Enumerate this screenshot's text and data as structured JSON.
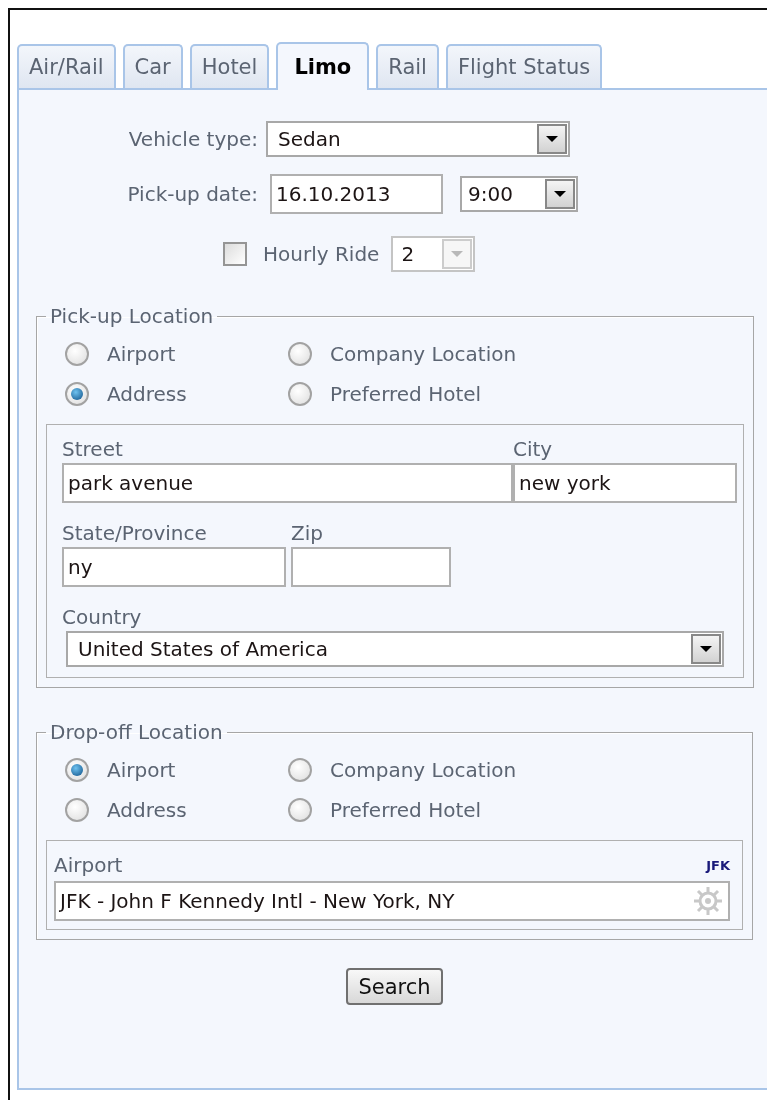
{
  "tabs": [
    {
      "label": "Air/Rail",
      "selected": false
    },
    {
      "label": "Car",
      "selected": false
    },
    {
      "label": "Hotel",
      "selected": false
    },
    {
      "label": "Limo",
      "selected": true
    },
    {
      "label": "Rail",
      "selected": false
    },
    {
      "label": "Flight Status",
      "selected": false
    }
  ],
  "vehicle_type": {
    "label": "Vehicle type:",
    "value": "Sedan"
  },
  "pickup_date": {
    "label": "Pick-up date:",
    "date": "16.10.2013",
    "time": "9:00"
  },
  "hourly_ride": {
    "label": "Hourly Ride",
    "checked": false,
    "hours": "2",
    "hours_disabled": true
  },
  "locations": [
    {
      "legend": "Pick-up Location",
      "kind": "address",
      "options": [
        {
          "label": "Airport",
          "selected": false
        },
        {
          "label": "Company Location",
          "selected": false
        },
        {
          "label": "Address",
          "selected": true
        },
        {
          "label": "Preferred Hotel",
          "selected": false
        }
      ],
      "street": {
        "label": "Street",
        "value": "park avenue"
      },
      "city": {
        "label": "City",
        "value": "new york"
      },
      "state": {
        "label": "State/Province",
        "value": "ny"
      },
      "zip": {
        "label": "Zip"
      },
      "country": {
        "label": "Country",
        "value": "United States of America"
      }
    },
    {
      "legend": "Drop-off Location",
      "kind": "airport",
      "options": [
        {
          "label": "Airport",
          "selected": true
        },
        {
          "label": "Company Location",
          "selected": false
        },
        {
          "label": "Address",
          "selected": false
        },
        {
          "label": "Preferred Hotel",
          "selected": false
        }
      ],
      "airport": {
        "label": "Airport",
        "code": "JFK",
        "value": "JFK - John F Kennedy Intl - New York, NY"
      }
    }
  ],
  "search_button": "Search"
}
